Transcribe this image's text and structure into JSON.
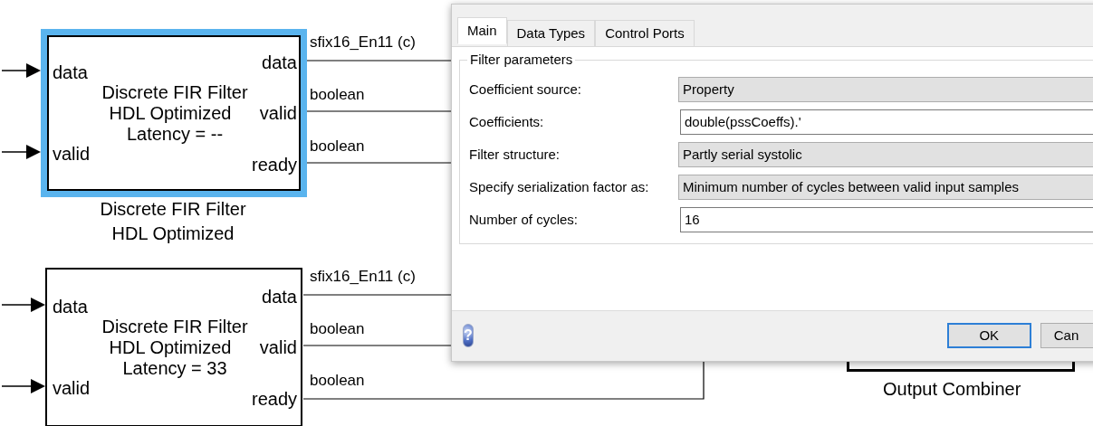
{
  "blocks": [
    {
      "selected": true,
      "inputs": [
        "data",
        "valid"
      ],
      "outputs": [
        "data",
        "valid",
        "ready"
      ],
      "title_lines": [
        "Discrete FIR Filter",
        "HDL Optimized",
        "Latency = --"
      ],
      "caption_lines": [
        "Discrete FIR Filter",
        "HDL Optimized"
      ],
      "signals": [
        "sfix16_En11 (c)",
        "boolean",
        "boolean"
      ]
    },
    {
      "selected": false,
      "inputs": [
        "data",
        "valid"
      ],
      "outputs": [
        "data",
        "valid",
        "ready"
      ],
      "title_lines": [
        "Discrete FIR Filter",
        "HDL Optimized",
        "Latency = 33"
      ],
      "signals": [
        "sfix16_En11 (c)",
        "boolean",
        "boolean"
      ]
    }
  ],
  "output_combiner": {
    "caption": "Output Combiner"
  },
  "dialog": {
    "tabs": [
      {
        "label": "Main",
        "selected": true
      },
      {
        "label": "Data Types",
        "selected": false
      },
      {
        "label": "Control Ports",
        "selected": false
      }
    ],
    "group": {
      "title": "Filter parameters",
      "params": [
        {
          "label": "Coefficient source:",
          "kind": "dropdown",
          "value": "Property"
        },
        {
          "label": "Coefficients:",
          "kind": "edit",
          "value": "double(pssCoeffs).'"
        },
        {
          "label": "Filter structure:",
          "kind": "dropdown",
          "value": "Partly serial systolic"
        },
        {
          "label": "Specify serialization factor as:",
          "kind": "dropdown",
          "value": "Minimum number of cycles between valid input samples"
        },
        {
          "label": "Number of cycles:",
          "kind": "edit",
          "value": "16"
        }
      ]
    },
    "help_glyph": "?",
    "buttons": [
      {
        "label": "OK",
        "default": true
      },
      {
        "label": "Can",
        "default": false
      }
    ]
  }
}
